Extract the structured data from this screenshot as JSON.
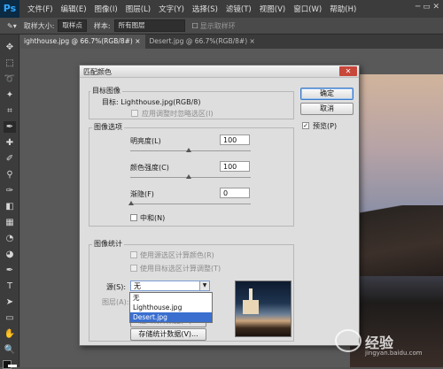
{
  "app": {
    "logo": "Ps"
  },
  "menubar": {
    "items": [
      "文件(F)",
      "编辑(E)",
      "图像(I)",
      "图层(L)",
      "文字(Y)",
      "选择(S)",
      "滤镜(T)",
      "视图(V)",
      "窗口(W)",
      "帮助(H)"
    ]
  },
  "optionsbar": {
    "sample_size_label": "取样大小:",
    "sample_size_value": "取样点",
    "sample_label": "样本:",
    "sample_value": "所有图层",
    "show_ring_label": "显示取样环"
  },
  "tabs": [
    {
      "label": "ighthouse.jpg @ 66.7%(RGB/8#) ×"
    },
    {
      "label": "Desert.jpg @ 66.7%(RGB/8#) ×"
    }
  ],
  "dialog": {
    "title": "匹配颜色",
    "target_group": "目标图像",
    "target_label": "目标: Lighthouse.jpg(RGB/8)",
    "ignore_selection": "应用调整时忽略选区(I)",
    "options_group": "图像选项",
    "luminance_label": "明亮度(L)",
    "luminance_value": "100",
    "intensity_label": "颜色强度(C)",
    "intensity_value": "100",
    "fade_label": "渐隐(F)",
    "fade_value": "0",
    "neutralize": "中和(N)",
    "stats_group": "图像统计",
    "use_source_sel": "使用源选区计算颜色(R)",
    "use_target_sel": "使用目标选区计算调整(T)",
    "source_label": "源(S):",
    "source_value": "无",
    "layer_label": "图层(A):",
    "load_btn": "载入统计数据(O)...",
    "save_btn": "存储统计数据(V)...",
    "ok_btn": "确定",
    "cancel_btn": "取消",
    "preview_label": "预览(P)",
    "dropdown_items": [
      "无",
      "Lighthouse.jpg",
      "Desert.jpg"
    ],
    "dropdown_selected": "Desert.jpg"
  },
  "watermark": {
    "text": "经验",
    "sub": "jingyan.baidu.com"
  }
}
